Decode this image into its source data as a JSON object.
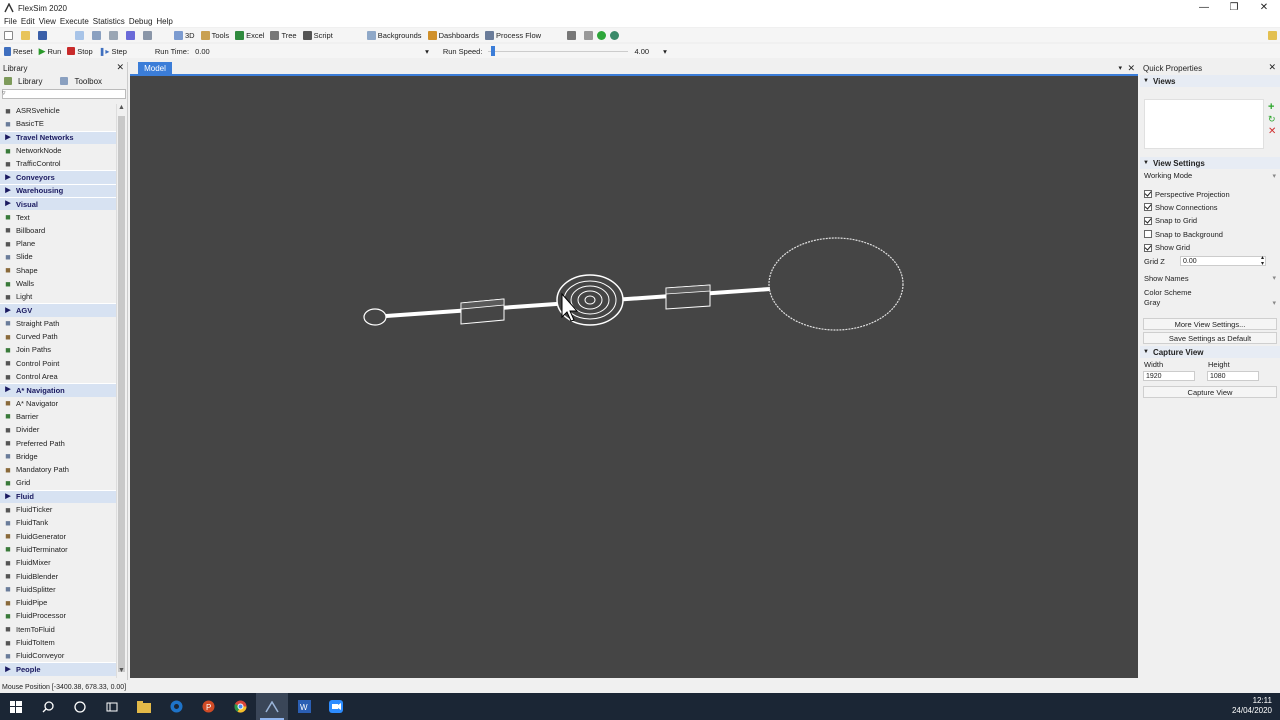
{
  "window": {
    "title": "FlexSim 2020",
    "minimize": "—",
    "restore": "❐",
    "close": "✕"
  },
  "menu": [
    "File",
    "Edit",
    "View",
    "Execute",
    "Statistics",
    "Debug",
    "Help"
  ],
  "toolbar": {
    "view3d": "3D",
    "tools": "Tools",
    "excel": "Excel",
    "tree": "Tree",
    "script": "Script",
    "backgrounds": "Backgrounds",
    "dashboards": "Dashboards",
    "process_flow": "Process Flow"
  },
  "run_toolbar": {
    "reset": "Reset",
    "run": "Run",
    "stop": "Stop",
    "step": "Step",
    "run_time_label": "Run Time:",
    "run_time_value": "0.00",
    "run_speed_label": "Run Speed:",
    "run_speed_value": "4.00"
  },
  "library": {
    "title": "Library",
    "tabs": [
      "Library",
      "Toolbox"
    ],
    "items": [
      {
        "label": "ASRSvehicle",
        "type": "item",
        "icon": "asrs-vehicle-icon"
      },
      {
        "label": "BasicTE",
        "type": "item",
        "icon": "basic-te-icon"
      },
      {
        "label": "Travel Networks",
        "type": "category"
      },
      {
        "label": "NetworkNode",
        "type": "item",
        "icon": "network-node-icon"
      },
      {
        "label": "TrafficControl",
        "type": "item",
        "icon": "traffic-control-icon"
      },
      {
        "label": "Conveyors",
        "type": "category"
      },
      {
        "label": "Warehousing",
        "type": "category"
      },
      {
        "label": "Visual",
        "type": "category"
      },
      {
        "label": "Text",
        "type": "item",
        "icon": "text-icon"
      },
      {
        "label": "Billboard",
        "type": "item",
        "icon": "billboard-icon"
      },
      {
        "label": "Plane",
        "type": "item",
        "icon": "plane-icon"
      },
      {
        "label": "Slide",
        "type": "item",
        "icon": "slide-icon"
      },
      {
        "label": "Shape",
        "type": "item",
        "icon": "shape-icon"
      },
      {
        "label": "Walls",
        "type": "item",
        "icon": "walls-icon"
      },
      {
        "label": "Light",
        "type": "item",
        "icon": "light-icon"
      },
      {
        "label": "AGV",
        "type": "category"
      },
      {
        "label": "Straight Path",
        "type": "item",
        "icon": "straight-path-icon"
      },
      {
        "label": "Curved Path",
        "type": "item",
        "icon": "curved-path-icon"
      },
      {
        "label": "Join Paths",
        "type": "item",
        "icon": "join-paths-icon"
      },
      {
        "label": "Control Point",
        "type": "item",
        "icon": "control-point-icon"
      },
      {
        "label": "Control Area",
        "type": "item",
        "icon": "control-area-icon"
      },
      {
        "label": "A* Navigation",
        "type": "category"
      },
      {
        "label": "A* Navigator",
        "type": "item",
        "icon": "astar-navigator-icon"
      },
      {
        "label": "Barrier",
        "type": "item",
        "icon": "barrier-icon"
      },
      {
        "label": "Divider",
        "type": "item",
        "icon": "divider-icon"
      },
      {
        "label": "Preferred Path",
        "type": "item",
        "icon": "preferred-path-icon"
      },
      {
        "label": "Bridge",
        "type": "item",
        "icon": "bridge-icon"
      },
      {
        "label": "Mandatory Path",
        "type": "item",
        "icon": "mandatory-path-icon"
      },
      {
        "label": "Grid",
        "type": "item",
        "icon": "grid-icon"
      },
      {
        "label": "Fluid",
        "type": "category"
      },
      {
        "label": "FluidTicker",
        "type": "item",
        "icon": "fluid-ticker-icon"
      },
      {
        "label": "FluidTank",
        "type": "item",
        "icon": "fluid-tank-icon"
      },
      {
        "label": "FluidGenerator",
        "type": "item",
        "icon": "fluid-generator-icon"
      },
      {
        "label": "FluidTerminator",
        "type": "item",
        "icon": "fluid-terminator-icon"
      },
      {
        "label": "FluidMixer",
        "type": "item",
        "icon": "fluid-mixer-icon"
      },
      {
        "label": "FluidBlender",
        "type": "item",
        "icon": "fluid-blender-icon"
      },
      {
        "label": "FluidSplitter",
        "type": "item",
        "icon": "fluid-splitter-icon"
      },
      {
        "label": "FluidPipe",
        "type": "item",
        "icon": "fluid-pipe-icon"
      },
      {
        "label": "FluidProcessor",
        "type": "item",
        "icon": "fluid-processor-icon"
      },
      {
        "label": "ItemToFluid",
        "type": "item",
        "icon": "item-to-fluid-icon"
      },
      {
        "label": "FluidToItem",
        "type": "item",
        "icon": "fluid-to-item-icon"
      },
      {
        "label": "FluidConveyor",
        "type": "item",
        "icon": "fluid-conveyor-icon"
      },
      {
        "label": "People",
        "type": "category"
      }
    ]
  },
  "document": {
    "tab": "Model"
  },
  "quick_properties": {
    "title": "Quick Properties",
    "views_header": "Views",
    "view_settings_header": "View Settings",
    "working_mode": "Working Mode",
    "checkboxes": [
      {
        "label": "Perspective Projection",
        "checked": true
      },
      {
        "label": "Show Connections",
        "checked": true
      },
      {
        "label": "Snap to Grid",
        "checked": true
      },
      {
        "label": "Snap to Background",
        "checked": false
      },
      {
        "label": "Show Grid",
        "checked": true
      }
    ],
    "grid_z_label": "Grid Z",
    "grid_z_value": "0.00",
    "show_names": "Show Names",
    "color_scheme_label": "Color Scheme",
    "color_scheme_value": "Gray",
    "more_view_settings": "More View Settings...",
    "save_default": "Save Settings as Default",
    "capture_header": "Capture View",
    "width_label": "Width",
    "width_value": "1920",
    "height_label": "Height",
    "height_value": "1080",
    "capture_button": "Capture View"
  },
  "status": {
    "mouse_position": "Mouse Position [-3400.38, 678.33, 0.00]"
  },
  "clock": {
    "time": "12:11",
    "date": "24/04/2020"
  },
  "colors": {
    "viewport_bg": "#454545",
    "accent": "#3b7dd8",
    "category_bg": "#d7e2f2",
    "taskbar": "#1b2635"
  }
}
